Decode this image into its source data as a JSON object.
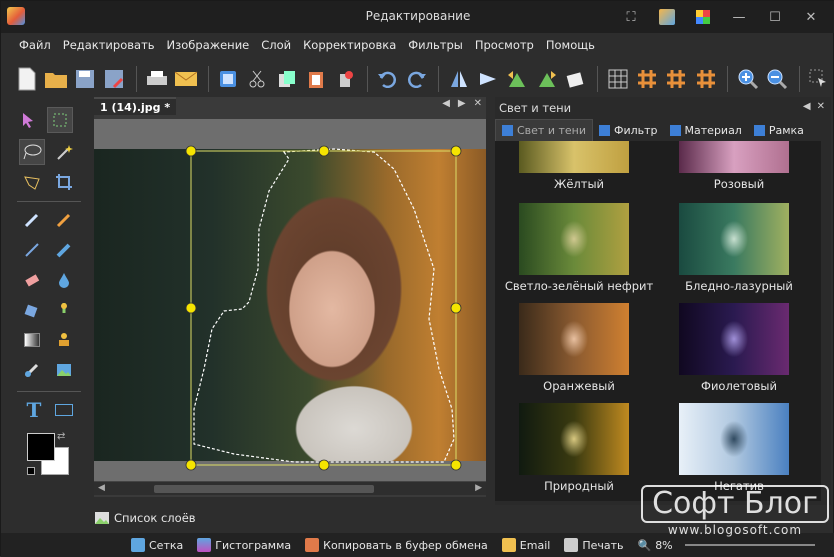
{
  "window": {
    "title": "Редактирование"
  },
  "menu": [
    "Файл",
    "Редактировать",
    "Изображение",
    "Слой",
    "Корректировка",
    "Фильтры",
    "Просмотр",
    "Помощь"
  ],
  "document": {
    "tab_label": "1 (14).jpg *"
  },
  "panel": {
    "title": "Свет и тени",
    "tabs": [
      "Свет и тени",
      "Фильтр",
      "Материал",
      "Рамка"
    ],
    "effects": [
      "Жёлтый",
      "Розовый",
      "Светло-зелёный нефрит",
      "Бледно-лазурный",
      "Оранжевый",
      "Фиолетовый",
      "Природный",
      "Негатив"
    ]
  },
  "layers": {
    "label": "Список слоёв"
  },
  "status": {
    "grid": "Сетка",
    "histogram": "Гистограмма",
    "copy": "Копировать в буфер обмена",
    "email": "Email",
    "print": "Печать",
    "zoom": "8%"
  },
  "watermark": {
    "main": "Софт Блог",
    "sub": "www.blogosoft.com"
  },
  "colors": {
    "accent": "#3d7fd6",
    "selection_handle": "#f5e400",
    "fg_color": "#000000",
    "bg_color": "#ffffff"
  }
}
